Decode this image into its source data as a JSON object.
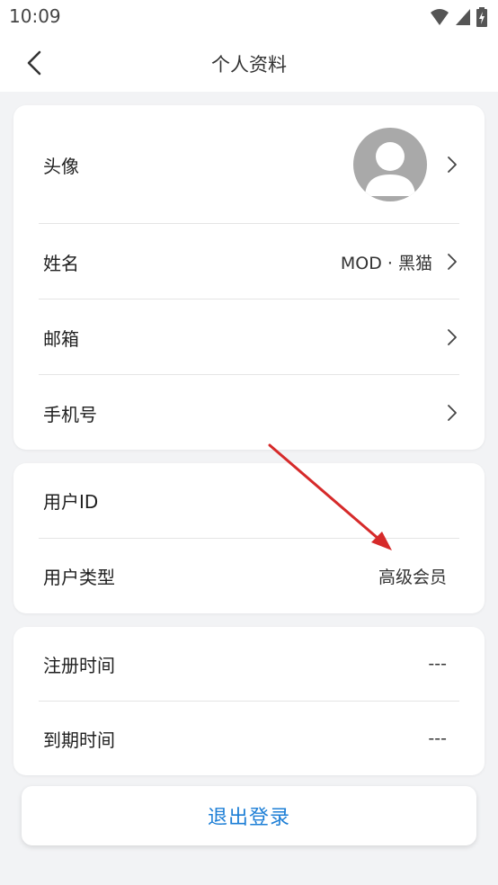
{
  "status": {
    "time": "10:09"
  },
  "header": {
    "title": "个人资料"
  },
  "profile": {
    "avatar_label": "头像",
    "name_label": "姓名",
    "name_value": "MOD · 黑猫",
    "email_label": "邮箱",
    "phone_label": "手机号"
  },
  "account": {
    "user_id_label": "用户ID",
    "user_type_label": "用户类型",
    "user_type_value": "高级会员"
  },
  "dates": {
    "register_label": "注册时间",
    "register_value": "---",
    "expire_label": "到期时间",
    "expire_value": "---"
  },
  "logout_label": "退出登录",
  "colors": {
    "accent": "#1e7fd6",
    "annotation_arrow": "#d62a2a"
  },
  "icons": [
    "back-icon",
    "chevron-right-icon",
    "avatar-placeholder-icon",
    "wifi-icon",
    "signal-icon",
    "battery-icon"
  ]
}
